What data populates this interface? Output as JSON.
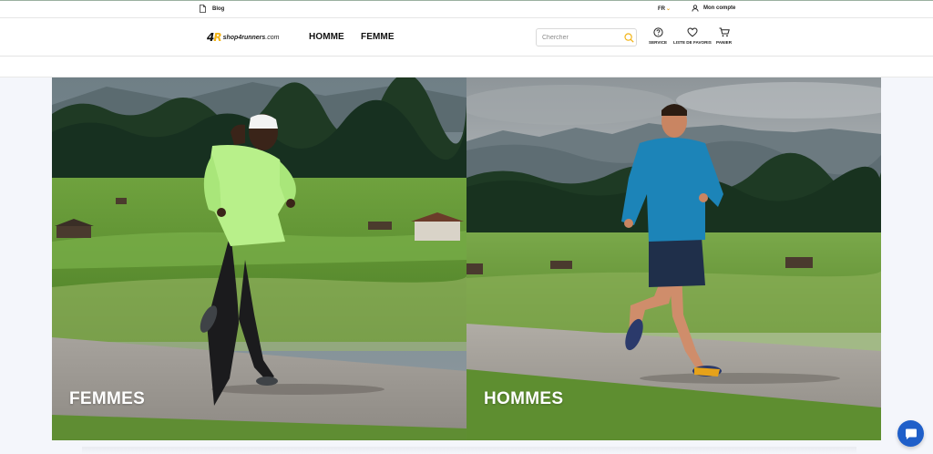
{
  "topbar": {
    "blog_label": "Blog",
    "blog_icon": "document-icon",
    "language": "FR",
    "account_label": "Mon compte",
    "account_icon": "user-icon"
  },
  "header": {
    "logo_mark": "4R",
    "logo_text": "shop4runners",
    "logo_domain": ".com",
    "nav": [
      "HOMME",
      "FEMME"
    ],
    "search_placeholder": "Chercher",
    "search_icon": "search-icon",
    "icons": [
      {
        "icon": "question-circle-icon",
        "label": "SERVICE"
      },
      {
        "icon": "heart-icon",
        "label": "LISTE DE FAVORIS"
      },
      {
        "icon": "cart-icon",
        "label": "PANIER"
      }
    ],
    "accent_color": "#f2b417"
  },
  "hero": {
    "left_caption": "FEMMES",
    "right_caption": "HOMMES"
  },
  "chat": {
    "icon": "chat-bubble-icon",
    "color": "#1f5fc9"
  }
}
